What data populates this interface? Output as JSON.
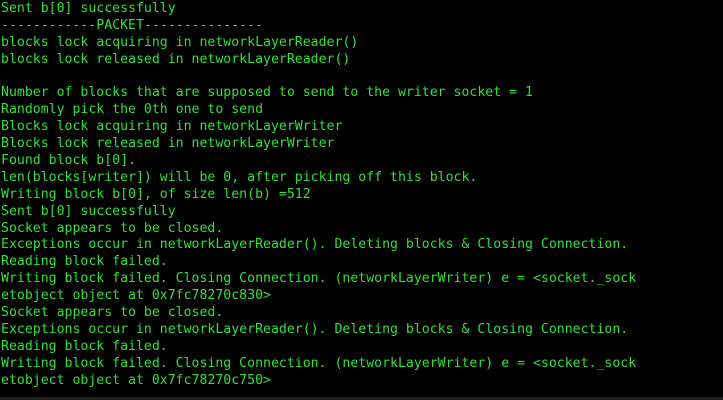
{
  "terminal": {
    "text_color": "#31e03a",
    "background_color": "#000000",
    "lines": [
      "Sent b[0] successfully",
      "------------PACKET---------------",
      "blocks lock acquiring in networkLayerReader()",
      "blocks lock released in networkLayerReader()",
      "",
      "Number of blocks that are supposed to send to the writer socket = 1",
      "Randomly pick the 0th one to send",
      "Blocks lock acquiring in networkLayerWriter",
      "Blocks lock released in networkLayerWriter",
      "Found block b[0].",
      "len(blocks[writer]) will be 0, after picking off this block.",
      "Writing block b[0], of size len(b) =512",
      "Sent b[0] successfully",
      "Socket appears to be closed.",
      "Exceptions occur in networkLayerReader(). Deleting blocks & Closing Connection.",
      "Reading block failed.",
      "Writing block failed. Closing Connection. (networkLayerWriter) e = <socket._sock",
      "etobject object at 0x7fc78270c830>",
      "Socket appears to be closed.",
      "Exceptions occur in networkLayerReader(). Deleting blocks & Closing Connection.",
      "Reading block failed.",
      "Writing block failed. Closing Connection. (networkLayerWriter) e = <socket._sock",
      "etobject object at 0x7fc78270c750>"
    ]
  }
}
